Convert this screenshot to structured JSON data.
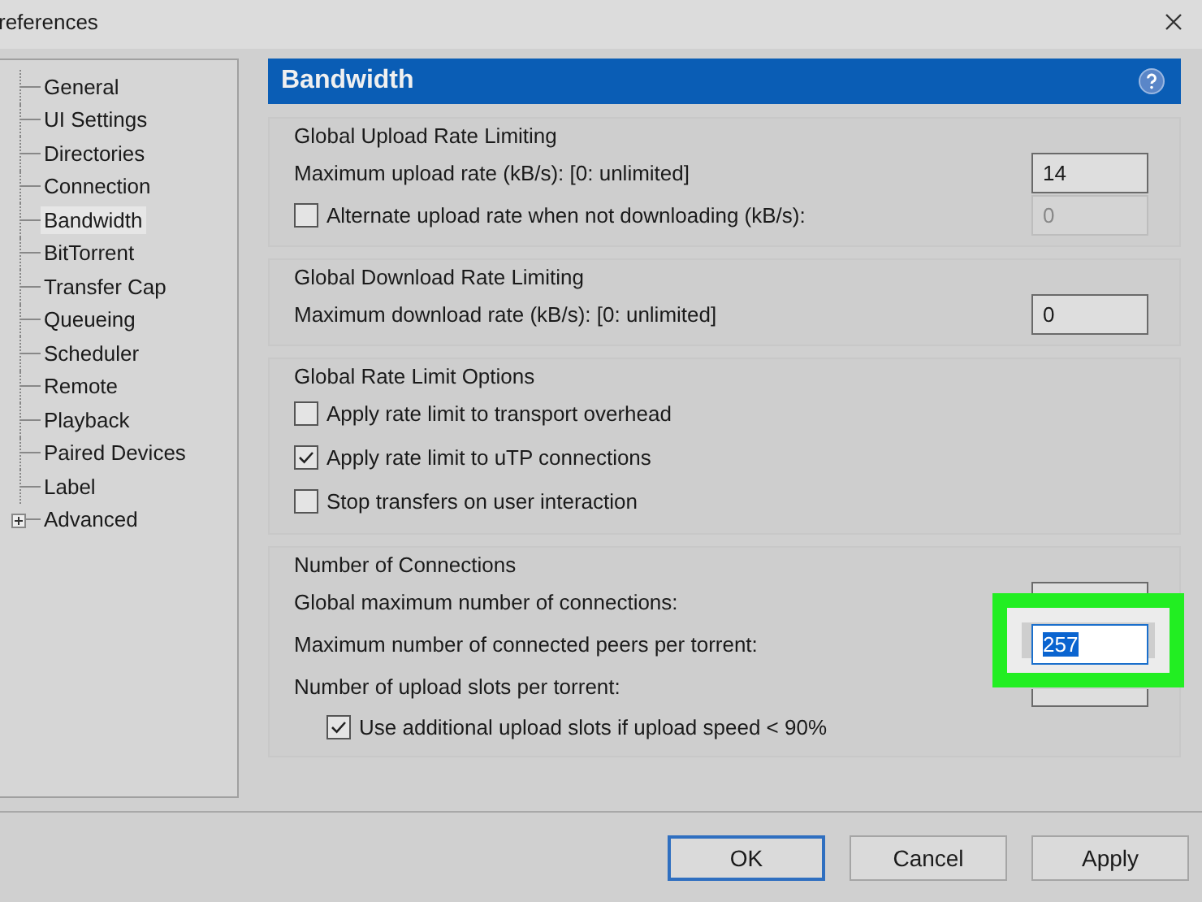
{
  "window": {
    "title": "references"
  },
  "sidebar": {
    "items": [
      {
        "label": "General",
        "selected": false
      },
      {
        "label": "UI Settings",
        "selected": false
      },
      {
        "label": "Directories",
        "selected": false
      },
      {
        "label": "Connection",
        "selected": false
      },
      {
        "label": "Bandwidth",
        "selected": true
      },
      {
        "label": "BitTorrent",
        "selected": false
      },
      {
        "label": "Transfer Cap",
        "selected": false
      },
      {
        "label": "Queueing",
        "selected": false
      },
      {
        "label": "Scheduler",
        "selected": false
      },
      {
        "label": "Remote",
        "selected": false
      },
      {
        "label": "Playback",
        "selected": false
      },
      {
        "label": "Paired Devices",
        "selected": false
      },
      {
        "label": "Label",
        "selected": false
      },
      {
        "label": "Advanced",
        "selected": false,
        "expanded": false
      }
    ]
  },
  "panel": {
    "title": "Bandwidth",
    "groups": [
      {
        "title": "Global Upload Rate Limiting",
        "rows": [
          {
            "kind": "field",
            "label": "Maximum upload rate (kB/s): [0: unlimited]",
            "value": "14",
            "disabled": false
          },
          {
            "kind": "check_field",
            "label": "Alternate upload rate when not downloading (kB/s):",
            "checked": false,
            "value": "0",
            "disabled": true
          }
        ]
      },
      {
        "title": "Global Download Rate Limiting",
        "rows": [
          {
            "kind": "field",
            "label": "Maximum download rate (kB/s): [0: unlimited]",
            "value": "0",
            "disabled": false
          }
        ]
      },
      {
        "title": "Global Rate Limit Options",
        "rows": [
          {
            "kind": "check",
            "label": "Apply rate limit to transport overhead",
            "checked": false
          },
          {
            "kind": "check",
            "label": "Apply rate limit to uTP connections",
            "checked": true
          },
          {
            "kind": "check",
            "label": "Stop transfers on user interaction",
            "checked": false
          }
        ]
      },
      {
        "title": "Number of Connections",
        "rows": [
          {
            "kind": "field",
            "label": "Global maximum number of connections:",
            "disabled": false
          },
          {
            "kind": "field",
            "label": "Maximum number of connected peers per torrent:",
            "value": "257",
            "disabled": false,
            "focused": true,
            "highlighted": true
          },
          {
            "kind": "field",
            "label": "Number of upload slots per torrent:",
            "disabled": false
          },
          {
            "kind": "check",
            "label": "Use additional upload slots if upload speed < 90%",
            "checked": true,
            "indented": true
          }
        ]
      }
    ]
  },
  "buttons": [
    {
      "label": "OK",
      "default": true
    },
    {
      "label": "Cancel",
      "default": false
    },
    {
      "label": "Apply",
      "default": false
    }
  ]
}
